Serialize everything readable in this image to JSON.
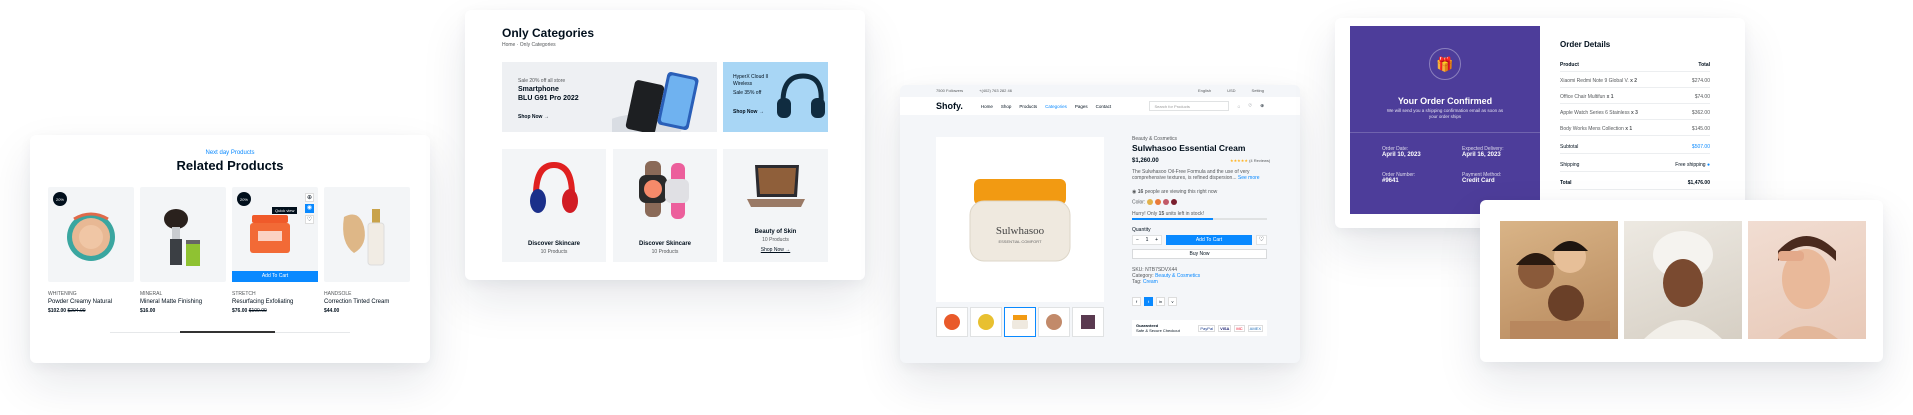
{
  "related": {
    "kicker": "Next day Products",
    "title": "Related Products",
    "add_to_cart": "Add To Cart",
    "quick_view": "Quick view",
    "products": [
      {
        "badge": "20%",
        "category": "WHITENING",
        "name": "Powder Creamy Natural",
        "price": "$102.00",
        "old_price": "$204.00"
      },
      {
        "badge": "",
        "category": "MINERAL",
        "name": "Mineral Matte Finishing",
        "price": "$16.00",
        "old_price": ""
      },
      {
        "badge": "20%",
        "category": "STRETCH",
        "name": "Resurfacing Exfoliating",
        "price": "$76.00",
        "old_price": "$100.00"
      },
      {
        "badge": "",
        "category": "HANDSOLE",
        "name": "Correction Tinted Cream",
        "price": "$44.00",
        "old_price": ""
      }
    ]
  },
  "categories": {
    "title": "Only Categories",
    "breadcrumb_home": "Home",
    "breadcrumb_current": "Only Categories",
    "banner1": {
      "kicker": "Sale 20% off all store",
      "line1": "Smartphone",
      "line2": "BLU G91 Pro 2022",
      "cta": "Shop Now →"
    },
    "banner2": {
      "line1": "HyperX Cloud II",
      "line2": "Wireless",
      "sub": "Sale 35% off",
      "cta": "Shop Now →"
    },
    "tiles": [
      {
        "name": "Discover Skincare",
        "count": "10 Products",
        "link": ""
      },
      {
        "name": "Discover Skincare",
        "count": "10 Products",
        "link": ""
      },
      {
        "name": "Beauty of Skin",
        "count": "10 Products",
        "link": "Shop Now →"
      }
    ]
  },
  "shop": {
    "followers": "7500 Followers",
    "phone": "+(402) 763 282 46",
    "language": "English",
    "currency": "USD",
    "setting": "Setting",
    "logo": "Shofy.",
    "nav": [
      "Home",
      "Shop",
      "Products",
      "Categories",
      "Pages",
      "Contact"
    ],
    "search_placeholder": "Search for Products",
    "product": {
      "jar_brand": "Sulwhasoo",
      "jar_line": "ESSENTIAL COMFORT",
      "category": "Beauty & Cosmetics",
      "title": "Sulwhasoo Essential Cream",
      "price": "$1,260.00",
      "reviews": "(4 Reviews)",
      "description": "The Sulwhasoo Oil-Free Formula and the use of very comprehensive textures, is refined dispersion...",
      "see_more": "See more",
      "viewers_count": "16",
      "viewers_text": "people are viewing this right now",
      "color_label": "Color:",
      "stock_prefix": "Hurry! Only",
      "stock_count": "15",
      "stock_suffix": "units left in stock!",
      "stock_fraction": 0.6,
      "quantity_label": "Quantity",
      "quantity": "1",
      "add_to_cart": "Add To Cart",
      "buy_now": "Buy Now",
      "sku_label": "SKU:",
      "sku": "NTB7SDVX44",
      "category_label": "Category:",
      "tag_label": "Tag:",
      "tag": "Cream",
      "guaranteed": "Guaranteed",
      "checkout": "Safe & Secure Checkout",
      "payments": [
        "PayPal",
        "VISA",
        "MC",
        "AMEX"
      ],
      "swatches": [
        "#e2b24a",
        "#e97a3a",
        "#c25a68",
        "#7a1f2e"
      ],
      "social": [
        "f",
        "t",
        "in",
        "v"
      ]
    }
  },
  "order": {
    "confirm_title": "Your Order Confirmed",
    "confirm_text": "We will send you a shipping confirmation email as soon as your order ships",
    "order_date_label": "Order Date:",
    "order_date": "April 10, 2023",
    "delivery_label": "Expected Delivery:",
    "delivery_date": "April 16, 2023",
    "order_number_label": "Order Number:",
    "order_number": "#9641",
    "payment_label": "Payment Method:",
    "payment_method": "Credit Card",
    "details_title": "Order Details",
    "col_product": "Product",
    "col_total": "Total",
    "items": [
      {
        "name": "Xiaomi Redmi Note 9 Global V.",
        "qty": "x 2",
        "total": "$274.00"
      },
      {
        "name": "Office Chair Multifun",
        "qty": "x 1",
        "total": "$74.00"
      },
      {
        "name": "Apple Watch Series 6 Stainless",
        "qty": "x 3",
        "total": "$362.00"
      },
      {
        "name": "Body Works Mens Collection",
        "qty": "x 1",
        "total": "$145.00"
      }
    ],
    "subtotal_label": "Subtotal",
    "subtotal": "$507.00",
    "shipping_label": "Shipping",
    "shipping": "Free shipping",
    "total_label": "Total",
    "total": "$1,476.00"
  },
  "colors": {
    "accent": "#0989ff",
    "purple": "#4d3d9a",
    "dark": "#010f1c"
  }
}
